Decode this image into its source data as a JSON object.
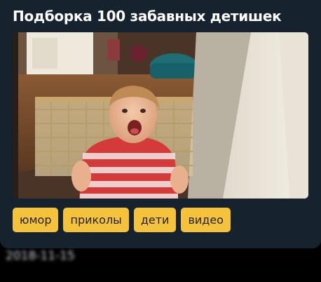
{
  "post": {
    "title": "Подборка 100 забавных детишек",
    "tags": [
      "юмор",
      "приколы",
      "дети",
      "видео"
    ],
    "date": "2018-11-15"
  },
  "colors": {
    "card_bg": "#16232f",
    "tag_bg": "#f5c33b",
    "tag_text": "#1f1f1f",
    "title_text": "#ffffff"
  }
}
